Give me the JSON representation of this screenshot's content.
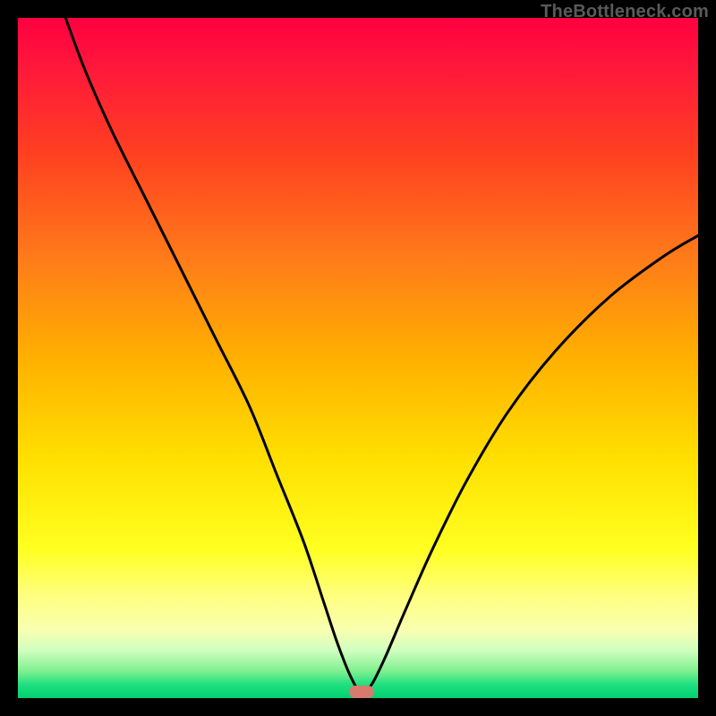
{
  "watermark_text": "TheBottleneck.com",
  "marker": {
    "x_pct": 50.5,
    "y_pct": 99.1
  },
  "chart_data": {
    "type": "line",
    "title": "",
    "xlabel": "",
    "ylabel": "",
    "xlim": [
      0,
      100
    ],
    "ylim": [
      0,
      100
    ],
    "grid": false,
    "series": [
      {
        "name": "curve",
        "x": [
          7,
          10,
          14,
          19,
          24,
          29,
          34,
          38,
          42,
          45,
          47,
          49,
          50.5,
          52,
          54,
          57,
          61,
          66,
          72,
          79,
          87,
          95,
          100
        ],
        "y": [
          100,
          92,
          83,
          73,
          63,
          53,
          43,
          33,
          23,
          14,
          8,
          3,
          0.8,
          2,
          6,
          13,
          22,
          32,
          42,
          51,
          59,
          65,
          68
        ]
      }
    ],
    "markers": [
      {
        "name": "bottleneck-point",
        "x": 50.5,
        "y": 0.9
      }
    ]
  }
}
